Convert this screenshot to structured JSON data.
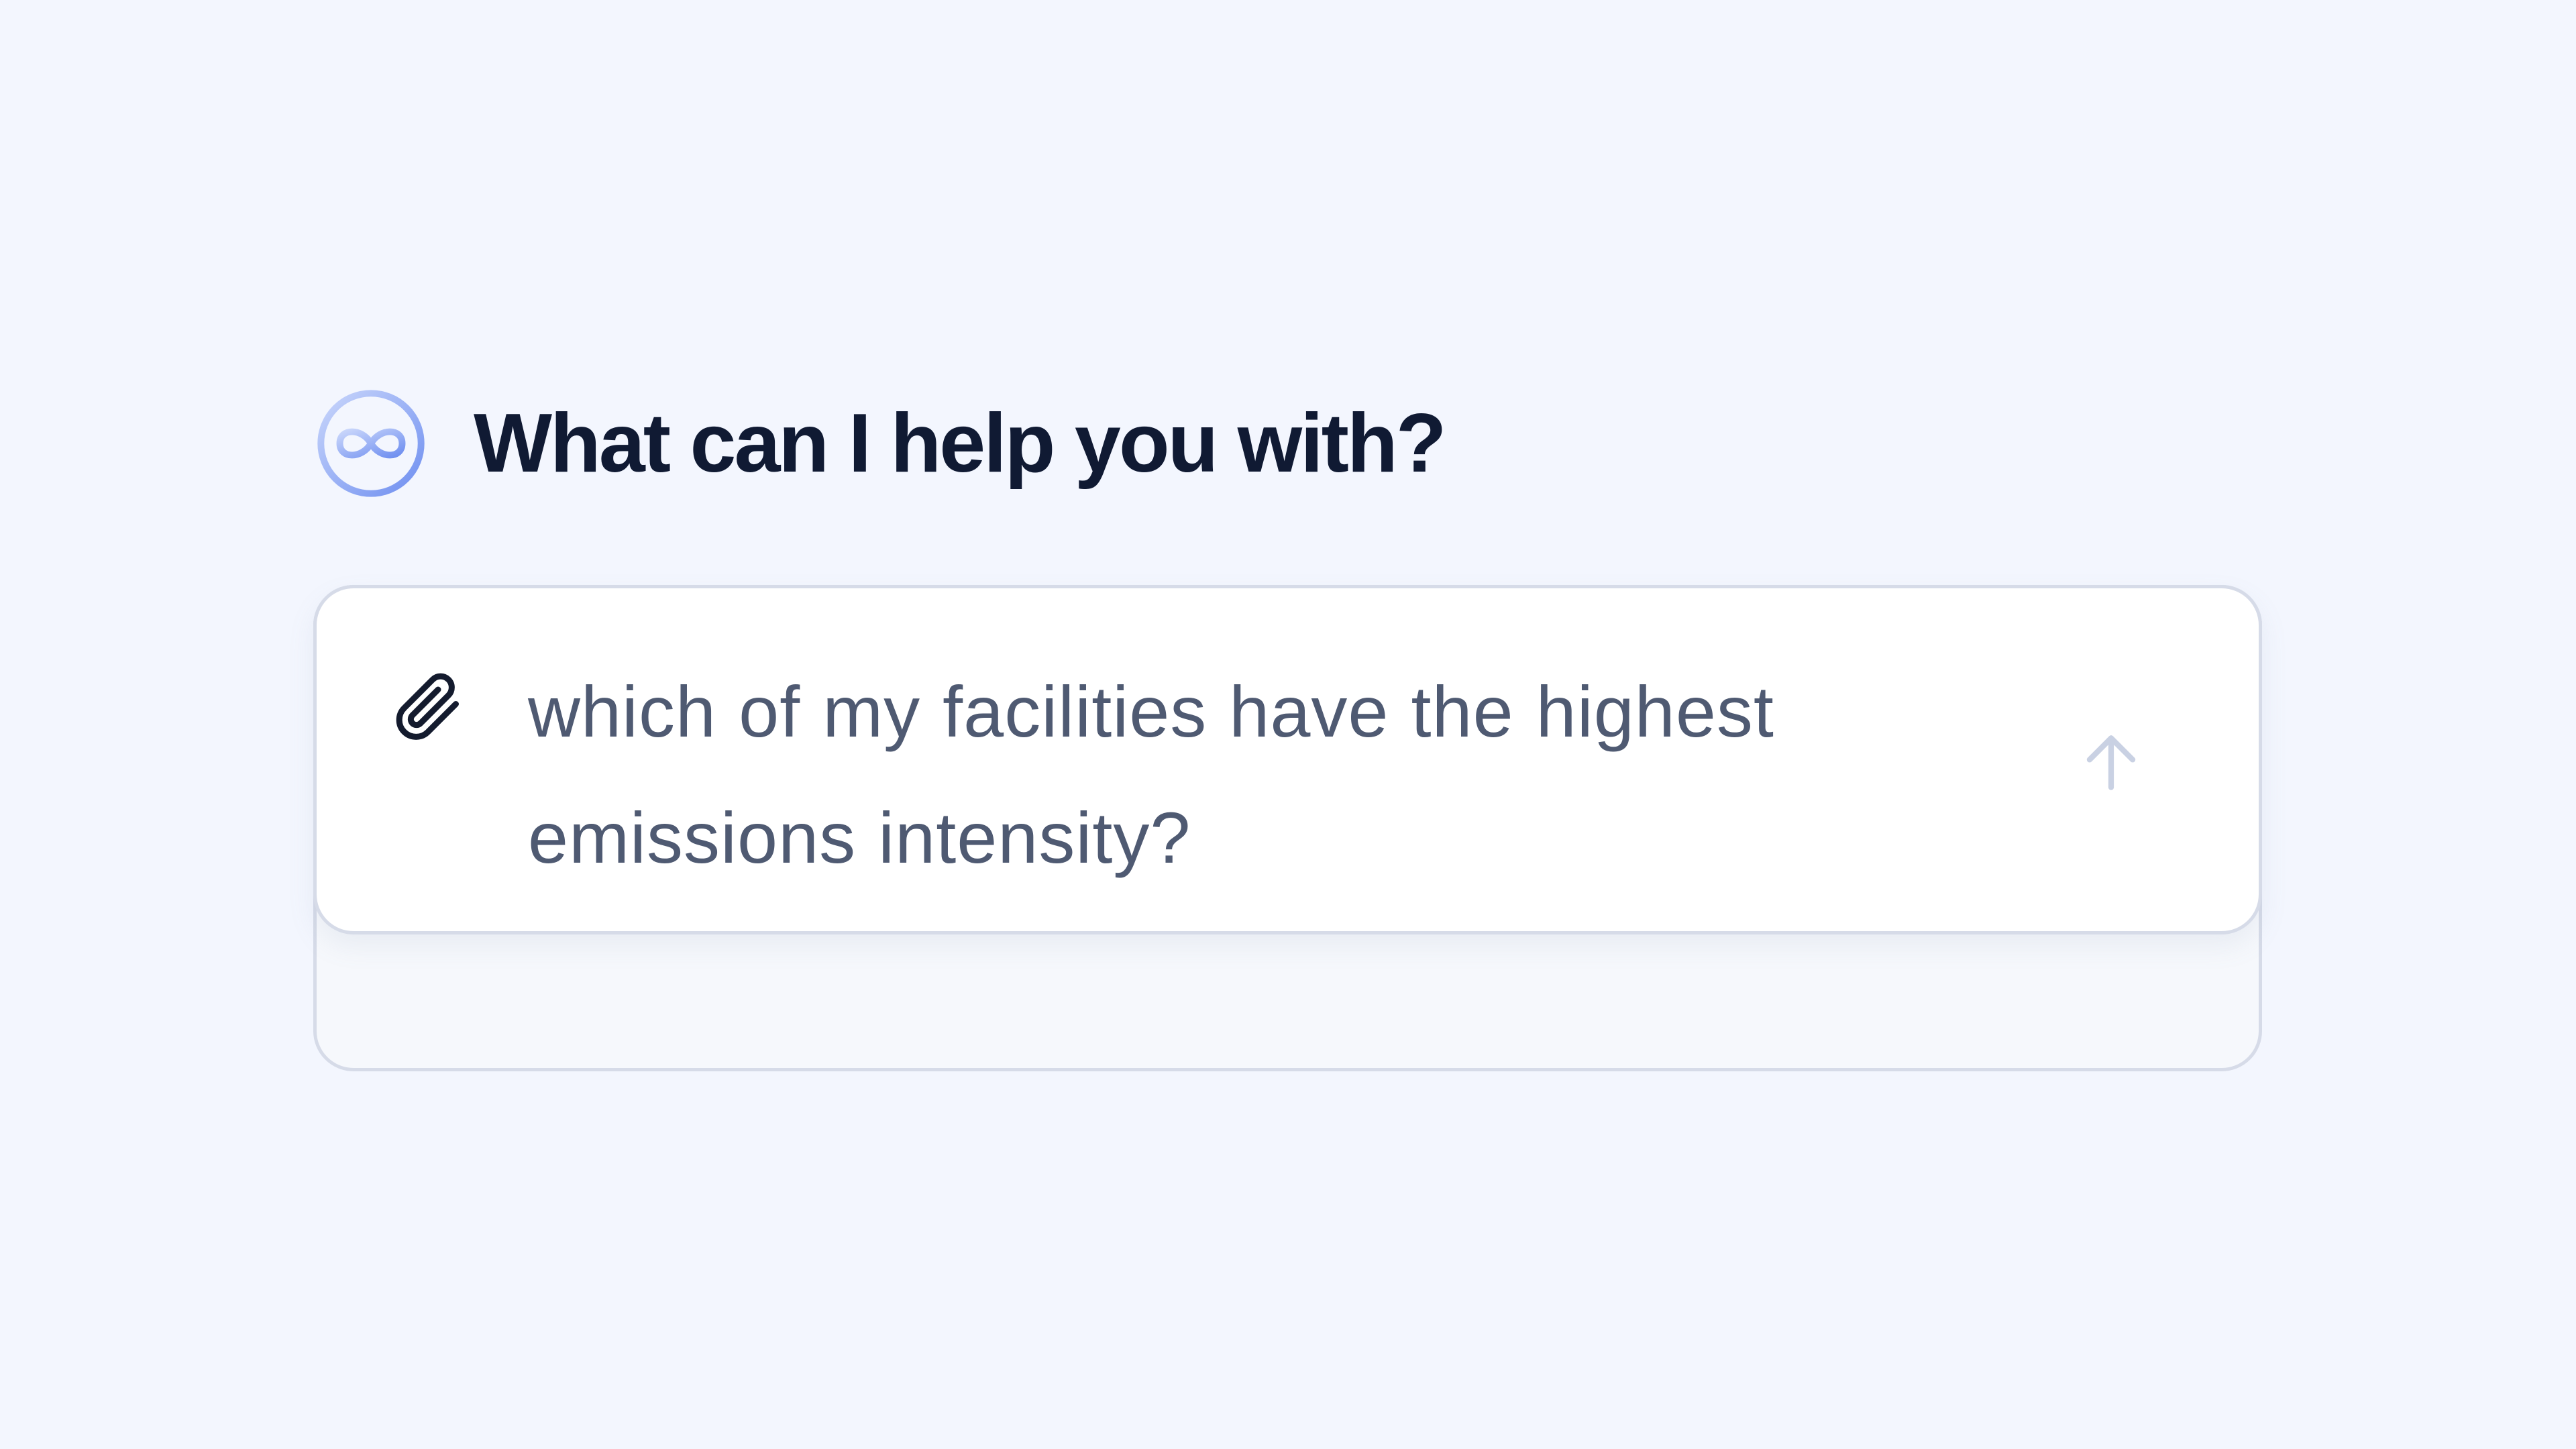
{
  "header": {
    "logo_icon": "infinity-circle-logo-icon",
    "title": "What can I help you with?"
  },
  "composer": {
    "attach_icon": "paperclip-icon",
    "message": "which of my facilities have the highest emissions intensity?",
    "send_icon": "arrow-up-icon"
  },
  "colors": {
    "background": "#f3f6fe",
    "title": "#101a33",
    "message_text": "#4f5a72",
    "border": "#d6dbe8",
    "logo_accent": "#7b9bf0",
    "send_icon_disabled": "#c9d1e3"
  }
}
